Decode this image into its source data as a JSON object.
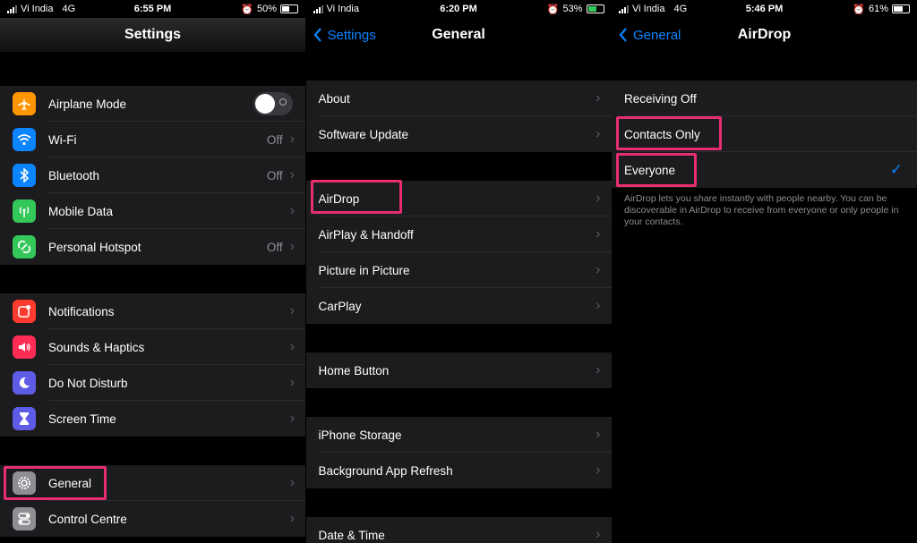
{
  "settings": {
    "status": {
      "carrier": "Vi India",
      "network": "4G",
      "time": "6:55 PM",
      "battery": "50%"
    },
    "title": "Settings",
    "group1": [
      {
        "label": "Airplane Mode",
        "icon": "airplane-icon",
        "color": "#ff9500",
        "toggle": "off"
      },
      {
        "label": "Wi-Fi",
        "value": "Off",
        "icon": "wifi-icon",
        "color": "#0a84ff"
      },
      {
        "label": "Bluetooth",
        "value": "Off",
        "icon": "bluetooth-icon",
        "color": "#0a84ff"
      },
      {
        "label": "Mobile Data",
        "value": "",
        "icon": "antenna-icon",
        "color": "#34c759"
      },
      {
        "label": "Personal Hotspot",
        "value": "Off",
        "icon": "hotspot-icon",
        "color": "#34c759"
      }
    ],
    "group2": [
      {
        "label": "Notifications",
        "icon": "notifications-icon",
        "color": "#ff3b30"
      },
      {
        "label": "Sounds & Haptics",
        "icon": "speaker-icon",
        "color": "#ff2d55"
      },
      {
        "label": "Do Not Disturb",
        "icon": "moon-icon",
        "color": "#5e5ce6"
      },
      {
        "label": "Screen Time",
        "icon": "hourglass-icon",
        "color": "#5e5ce6"
      }
    ],
    "group3": [
      {
        "label": "General",
        "icon": "gear-icon",
        "color": "#8e8e93"
      },
      {
        "label": "Control Centre",
        "icon": "switches-icon",
        "color": "#8e8e93"
      }
    ]
  },
  "general": {
    "status": {
      "carrier": "Vi India",
      "time": "6:20 PM",
      "battery": "53%"
    },
    "back_label": "Settings",
    "title": "General",
    "group1": [
      "About",
      "Software Update"
    ],
    "group2": [
      "AirDrop",
      "AirPlay & Handoff",
      "Picture in Picture",
      "CarPlay"
    ],
    "group3": [
      "Home Button"
    ],
    "group4": [
      "iPhone Storage",
      "Background App Refresh"
    ],
    "group5": [
      "Date & Time"
    ]
  },
  "airdrop": {
    "status": {
      "carrier": "Vi India",
      "network": "4G",
      "time": "5:46 PM",
      "battery": "61%"
    },
    "back_label": "General",
    "title": "AirDrop",
    "options": [
      "Receiving Off",
      "Contacts Only",
      "Everyone"
    ],
    "selected": "Everyone",
    "footer": "AirDrop lets you share instantly with people nearby. You can be discoverable in AirDrop to receive from everyone or only people in your contacts."
  },
  "colors": {
    "accent": "#0a84ff",
    "highlight": "#e62e70",
    "cell": "#1c1c1e"
  }
}
